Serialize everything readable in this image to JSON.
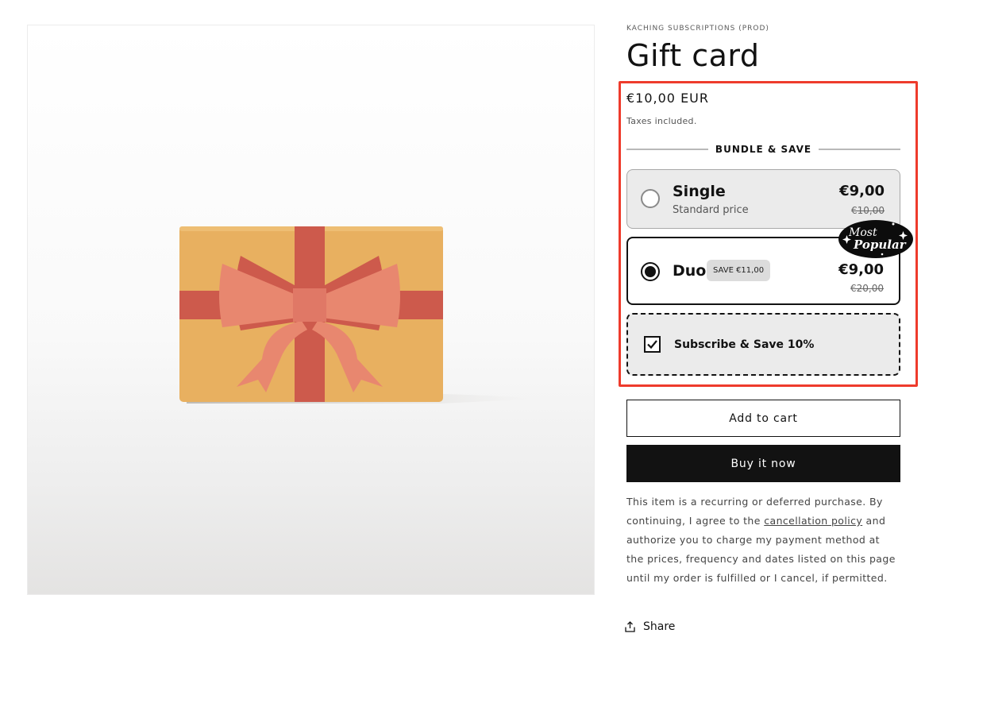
{
  "product": {
    "vendor": "KACHING SUBSCRIPTIONS (PROD)",
    "title": "Gift card",
    "price": "€10,00 EUR",
    "tax_note": "Taxes included.",
    "image_description_icon": "gift-box-image"
  },
  "bundle": {
    "heading": "BUNDLE & SAVE",
    "options": [
      {
        "name": "Single",
        "subtitle": "Standard price",
        "price": "€9,00",
        "compare_price": "€10,00",
        "selected": false
      },
      {
        "name": "Duo",
        "badge": "SAVE €11,00",
        "price": "€9,00",
        "compare_price": "€20,00",
        "selected": true,
        "ribbon": [
          "Most",
          "Popular"
        ]
      }
    ],
    "subscribe": {
      "label": "Subscribe & Save 10%",
      "checked": true
    }
  },
  "buttons": {
    "add_to_cart": "Add to cart",
    "buy_now": "Buy it now"
  },
  "disclaimer": {
    "before_link": "This item is a recurring or deferred purchase. By continuing, I agree to the ",
    "link": "cancellation policy",
    "after_link": " and authorize you to charge my payment method at the prices, frequency and dates listed on this page until my order is fulfilled or I cancel, if permitted."
  },
  "share": {
    "label": "Share",
    "icon": "share-icon"
  },
  "colors": {
    "highlight_border": "#ee3b2c",
    "box_body": "#e8b060",
    "ribbon": "#cd5a4c",
    "bow": "#e8876f",
    "buy_button": "#121212"
  }
}
